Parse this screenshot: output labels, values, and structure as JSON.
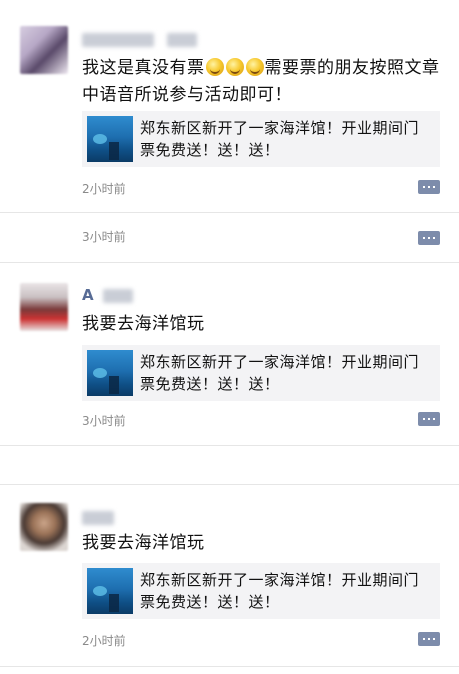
{
  "posts": [
    {
      "user_name": "",
      "text_before": "我这是真没有票",
      "text_after": "需要票的朋友按照文章中语音所说参与活动即可！",
      "link_title": "郑东新区新开了一家海洋馆！开业期间门票免费送！送！送！",
      "time": "2小时前"
    },
    {
      "time": "3小时前"
    },
    {
      "user_name": "A",
      "text": "我要去海洋馆玩",
      "link_title": "郑东新区新开了一家海洋馆！开业期间门票免费送！送！送！",
      "time": "3小时前"
    },
    {
      "user_name": "",
      "text": "我要去海洋馆玩",
      "link_title": "郑东新区新开了一家海洋馆！开业期间门票免费送！送！送！",
      "time": "2小时前"
    }
  ],
  "icons": {
    "comment": "comment-icon",
    "emoji": "laughing-emoji-icon"
  },
  "colors": {
    "name": "#576b95",
    "comment_button": "#7d8cab",
    "link_card_bg": "#f3f3f5"
  }
}
